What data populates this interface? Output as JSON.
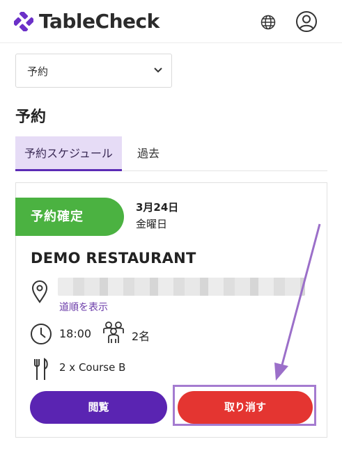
{
  "header": {
    "brand": "TableCheck",
    "icons": {
      "logo": "tablecheck-logo-icon",
      "language": "globe-icon",
      "account": "user-icon"
    }
  },
  "filter": {
    "selected": "予約",
    "icon": "chevron-down-icon"
  },
  "page": {
    "title": "予約"
  },
  "tabs": [
    {
      "label": "予約スケジュール",
      "active": true
    },
    {
      "label": "過去",
      "active": false
    }
  ],
  "reservation": {
    "status": "予約確定",
    "date": "3月24日",
    "weekday": "金曜日",
    "restaurant": "DEMO RESTAURANT",
    "directions_link": "道順を表示",
    "time": "18:00",
    "party": "2名",
    "course": "2 x Course B",
    "icons": {
      "location": "map-pin-icon",
      "time": "clock-icon",
      "party": "people-icon",
      "course": "cutlery-icon"
    },
    "actions": {
      "view": "閲覧",
      "cancel": "取り消す"
    }
  },
  "colors": {
    "brand_purple": "#5a24b2",
    "confirmed_green": "#4bb241",
    "cancel_red": "#e43531",
    "tab_active_bg": "#e6dcf6",
    "annotation": "#a47bd0"
  }
}
